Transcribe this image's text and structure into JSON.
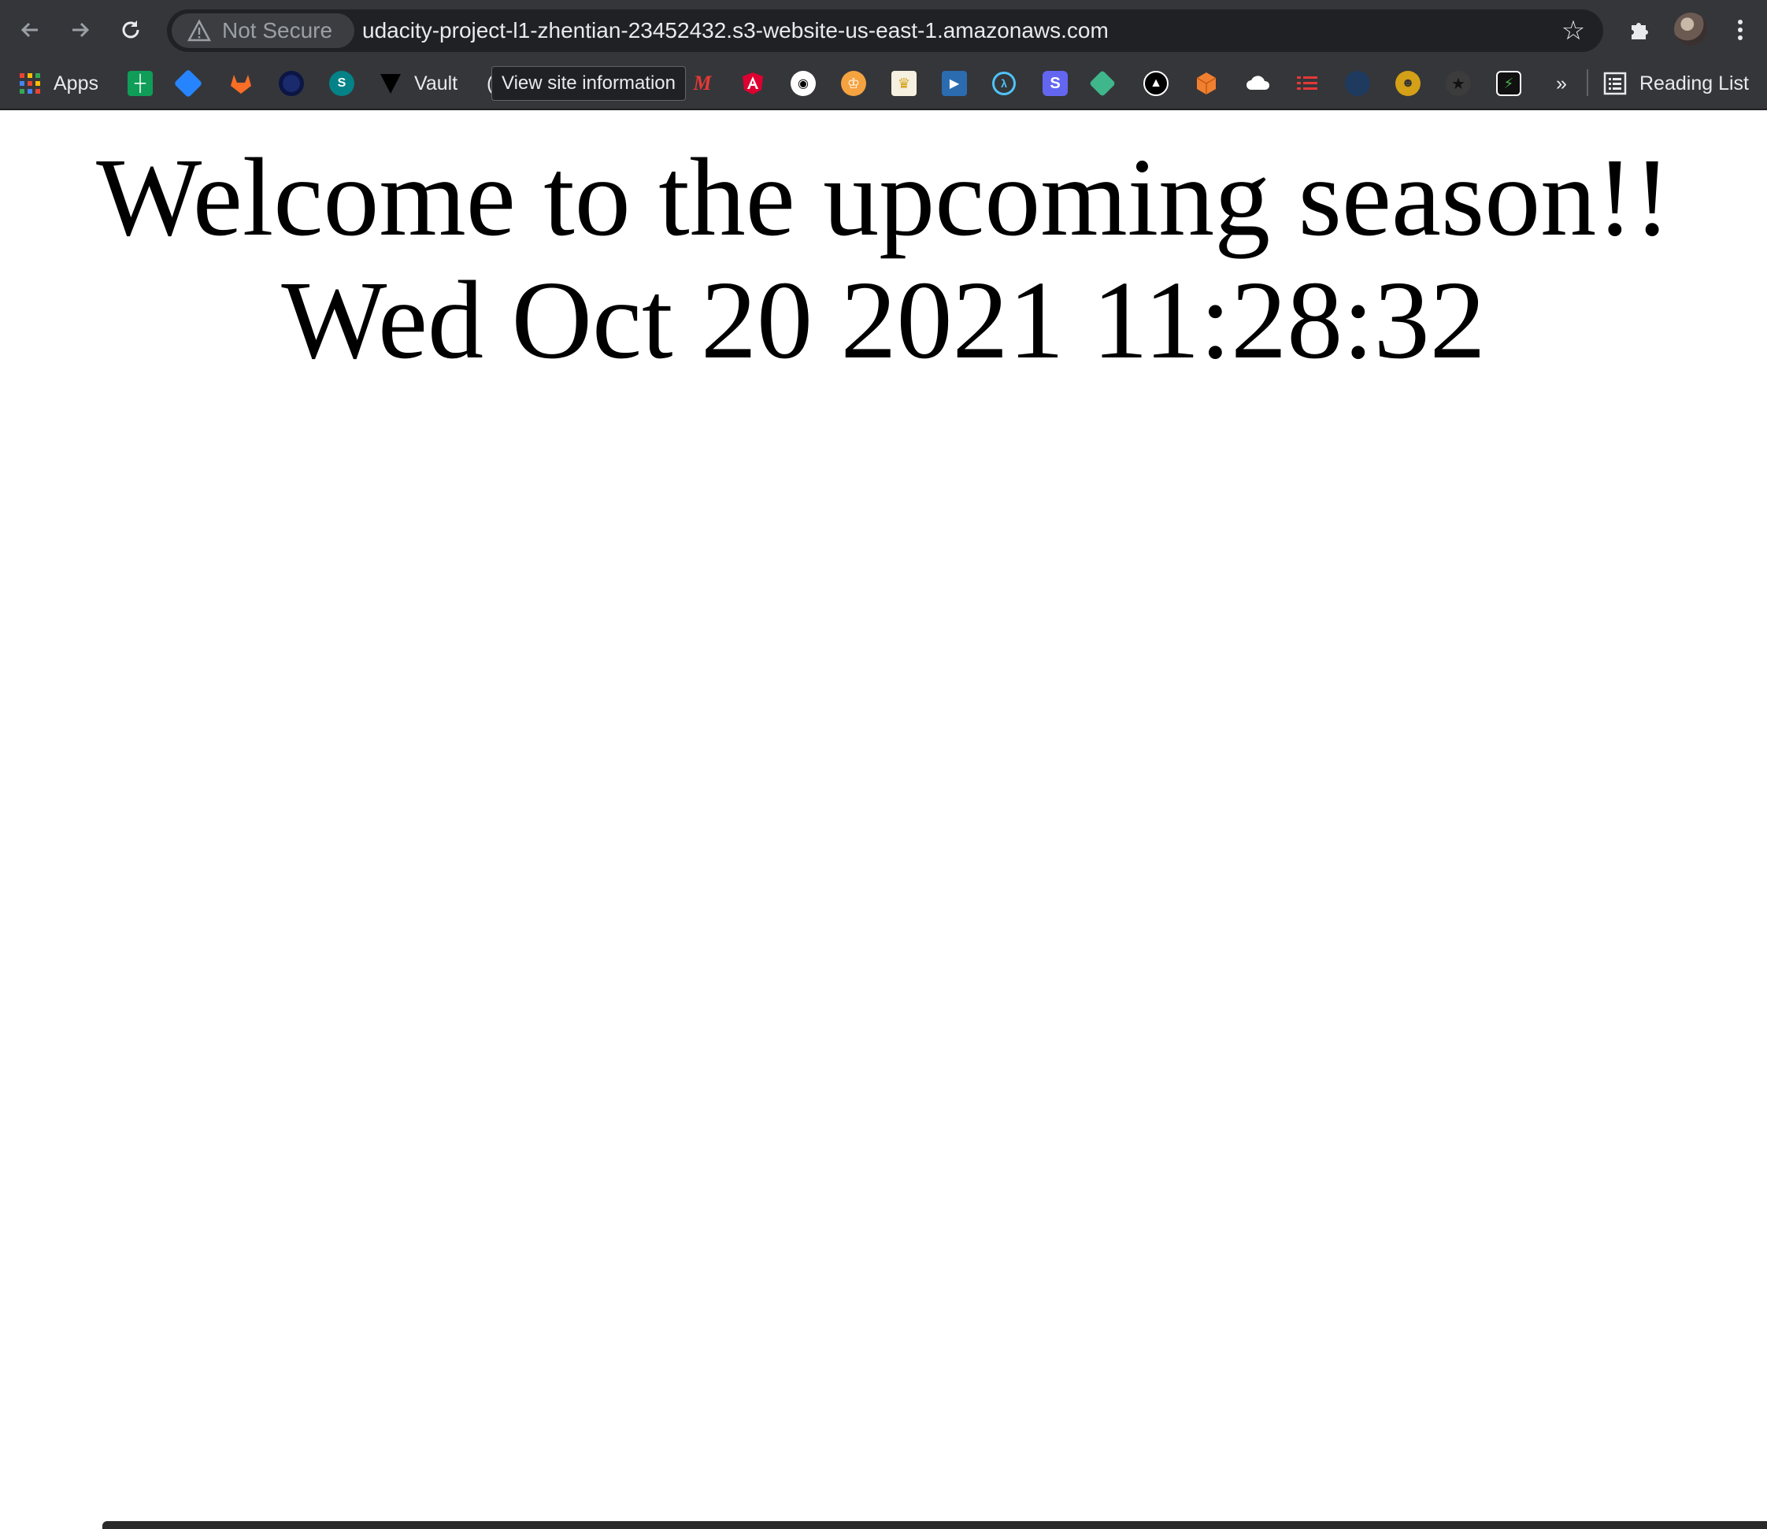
{
  "browser": {
    "security_label": "Not Secure",
    "url": "udacity-project-l1-zhentian-23452432.s3-website-us-east-1.amazonaws.com",
    "tooltip": "View site information",
    "more_label": "»",
    "reading_list_label": "Reading List"
  },
  "bookmarks": {
    "apps_label": "Apps",
    "vault_label": "Vault",
    "partial_label": "("
  },
  "page": {
    "heading": "Welcome to the upcoming season!!",
    "date_text": "Wed Oct 20 2021 11:28:32"
  }
}
